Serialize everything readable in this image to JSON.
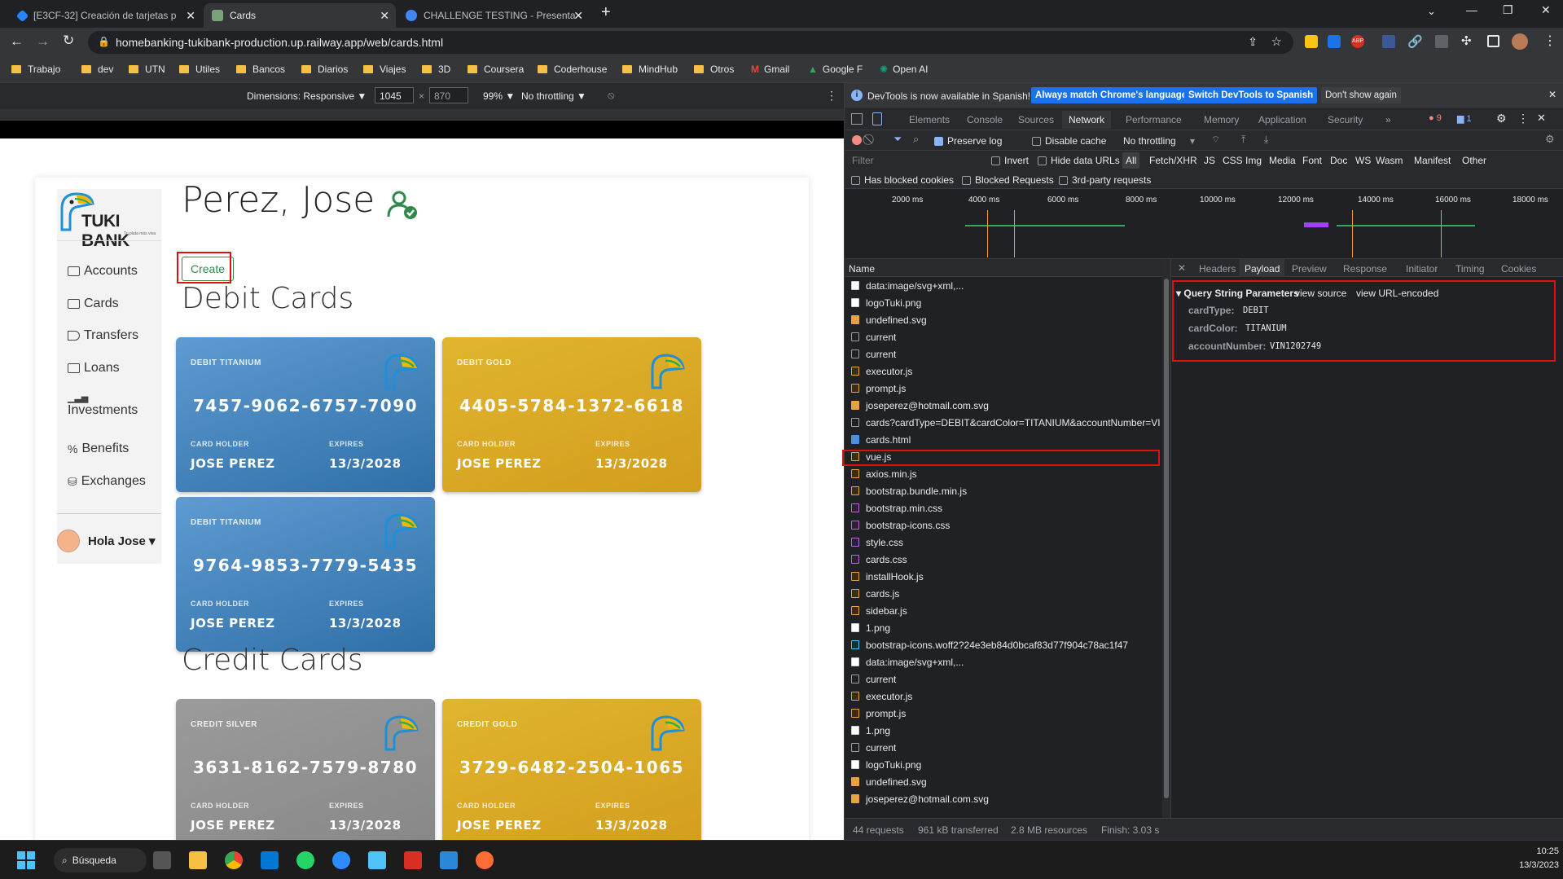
{
  "browser": {
    "tabs": [
      {
        "title": "[E3CF-32] Creación de tarjetas p",
        "favicon_color": "#2684ff"
      },
      {
        "title": "Cards",
        "favicon_color": "#7aa37a",
        "active": true
      },
      {
        "title": "CHALLENGE TESTING - Presenta",
        "favicon_color": "#4285f4"
      }
    ],
    "new_tab": "+",
    "url": "homebanking-tukibank-production.up.railway.app/web/cards.html",
    "bookmarks": [
      "Trabajo",
      "dev",
      "UTN",
      "Utiles",
      "Bancos",
      "Diarios",
      "Viajes",
      "3D",
      "Coursera",
      "Coderhouse",
      "MindHub",
      "Otros",
      "Gmail",
      "Google F",
      "Open AI"
    ]
  },
  "device_toolbar": {
    "dimensions_label": "Dimensions: Responsive ▼",
    "width": "1045",
    "height": "870",
    "zoom": "99% ▼",
    "throttle": "No throttling ▼"
  },
  "page": {
    "brand": "TUKI BANK",
    "brand_tagline": "Tu plata más viva",
    "user_name": "Perez, Jose",
    "create_label": "Create",
    "nav": [
      "Accounts",
      "Cards",
      "Transfers",
      "Loans",
      "Investments",
      "Benefits",
      "Exchanges"
    ],
    "greeting": "Hola Jose ▾",
    "debit_title": "Debit Cards",
    "credit_title": "Credit Cards",
    "card_holder_label": "CARD HOLDER",
    "expires_label": "EXPIRES",
    "cards": [
      {
        "type": "DEBIT TITANIUM",
        "number": "7457-9062-6757-7090",
        "holder": "JOSE PEREZ",
        "expires": "13/3/2028",
        "color": "#3f82c0"
      },
      {
        "type": "DEBIT GOLD",
        "number": "4405-5784-1372-6618",
        "holder": "JOSE PEREZ",
        "expires": "13/3/2028",
        "color": "#dba826"
      },
      {
        "type": "DEBIT TITANIUM",
        "number": "9764-9853-7779-5435",
        "holder": "JOSE PEREZ",
        "expires": "13/3/2028",
        "color": "#3f82c0"
      },
      {
        "type": "CREDIT SILVER",
        "number": "3631-8162-7579-8780",
        "holder": "JOSE PEREZ",
        "expires": "13/3/2028",
        "color": "#919191"
      },
      {
        "type": "CREDIT GOLD",
        "number": "3729-6482-2504-1065",
        "holder": "JOSE PEREZ",
        "expires": "13/3/2028",
        "color": "#dba826"
      }
    ]
  },
  "devtools": {
    "banner": "DevTools is now available in Spanish!",
    "banner_btn1": "Always match Chrome's language",
    "banner_btn2": "Switch DevTools to Spanish",
    "banner_btn3": "Don't show again",
    "tabs": [
      "Elements",
      "Console",
      "Sources",
      "Network",
      "Performance",
      "Memory",
      "Application",
      "Security",
      "»"
    ],
    "active_tab": "Network",
    "errors": "9",
    "messages": "1",
    "preserve_log": "Preserve log",
    "disable_cache": "Disable cache",
    "throttling": "No throttling",
    "filter_placeholder": "Filter",
    "invert": "Invert",
    "hide_data_urls": "Hide data URLs",
    "type_filters": [
      "All",
      "Fetch/XHR",
      "JS",
      "CSS",
      "Img",
      "Media",
      "Font",
      "Doc",
      "WS",
      "Wasm",
      "Manifest",
      "Other"
    ],
    "blocked_cookies": "Has blocked cookies",
    "blocked_requests": "Blocked Requests",
    "third_party": "3rd-party requests",
    "timeline_ticks": [
      "2000 ms",
      "4000 ms",
      "6000 ms",
      "8000 ms",
      "10000 ms",
      "12000 ms",
      "14000 ms",
      "16000 ms",
      "18000 ms"
    ],
    "name_header": "Name",
    "requests": [
      {
        "name": "data:image/svg+xml,...",
        "kind": "svgw"
      },
      {
        "name": "logoTuki.png",
        "kind": "img"
      },
      {
        "name": "undefined.svg",
        "kind": "svg"
      },
      {
        "name": "current",
        "kind": "doc"
      },
      {
        "name": "current",
        "kind": "doc"
      },
      {
        "name": "executor.js",
        "kind": "js"
      },
      {
        "name": "prompt.js",
        "kind": "js"
      },
      {
        "name": "joseperez@hotmail.com.svg",
        "kind": "svg"
      },
      {
        "name": "cards?cardType=DEBIT&cardColor=TITANIUM&accountNumber=VI",
        "kind": "doc"
      },
      {
        "name": "cards.html",
        "kind": "html"
      },
      {
        "name": "vue.js",
        "kind": "js"
      },
      {
        "name": "axios.min.js",
        "kind": "js"
      },
      {
        "name": "bootstrap.bundle.min.js",
        "kind": "js"
      },
      {
        "name": "bootstrap.min.css",
        "kind": "css"
      },
      {
        "name": "bootstrap-icons.css",
        "kind": "css"
      },
      {
        "name": "style.css",
        "kind": "css"
      },
      {
        "name": "cards.css",
        "kind": "css"
      },
      {
        "name": "installHook.js",
        "kind": "js"
      },
      {
        "name": "cards.js",
        "kind": "js"
      },
      {
        "name": "sidebar.js",
        "kind": "js"
      },
      {
        "name": "1.png",
        "kind": "img"
      },
      {
        "name": "bootstrap-icons.woff2?24e3eb84d0bcaf83d77f904c78ac1f47",
        "kind": "font"
      },
      {
        "name": "data:image/svg+xml,...",
        "kind": "svgw"
      },
      {
        "name": "current",
        "kind": "doc"
      },
      {
        "name": "executor.js",
        "kind": "js"
      },
      {
        "name": "prompt.js",
        "kind": "js"
      },
      {
        "name": "1.png",
        "kind": "img"
      },
      {
        "name": "current",
        "kind": "doc"
      },
      {
        "name": "logoTuki.png",
        "kind": "img"
      },
      {
        "name": "undefined.svg",
        "kind": "svg"
      },
      {
        "name": "joseperez@hotmail.com.svg",
        "kind": "svg"
      }
    ],
    "detail_tabs": [
      "Headers",
      "Payload",
      "Preview",
      "Response",
      "Initiator",
      "Timing",
      "Cookies"
    ],
    "active_detail_tab": "Payload",
    "query_title": "▾ Query String Parameters",
    "view_source": "view source",
    "view_url_encoded": "view URL-encoded",
    "params": [
      {
        "key": "cardType:",
        "value": "DEBIT"
      },
      {
        "key": "cardColor:",
        "value": "TITANIUM"
      },
      {
        "key": "accountNumber:",
        "value": "VIN1202749"
      }
    ],
    "status": {
      "requests": "44 requests",
      "transferred": "961 kB transferred",
      "resources": "2.8 MB resources",
      "finish": "Finish: 3.03 s"
    }
  },
  "taskbar": {
    "search": "Búsqueda",
    "time": "10:25",
    "date": "13/3/2023"
  }
}
